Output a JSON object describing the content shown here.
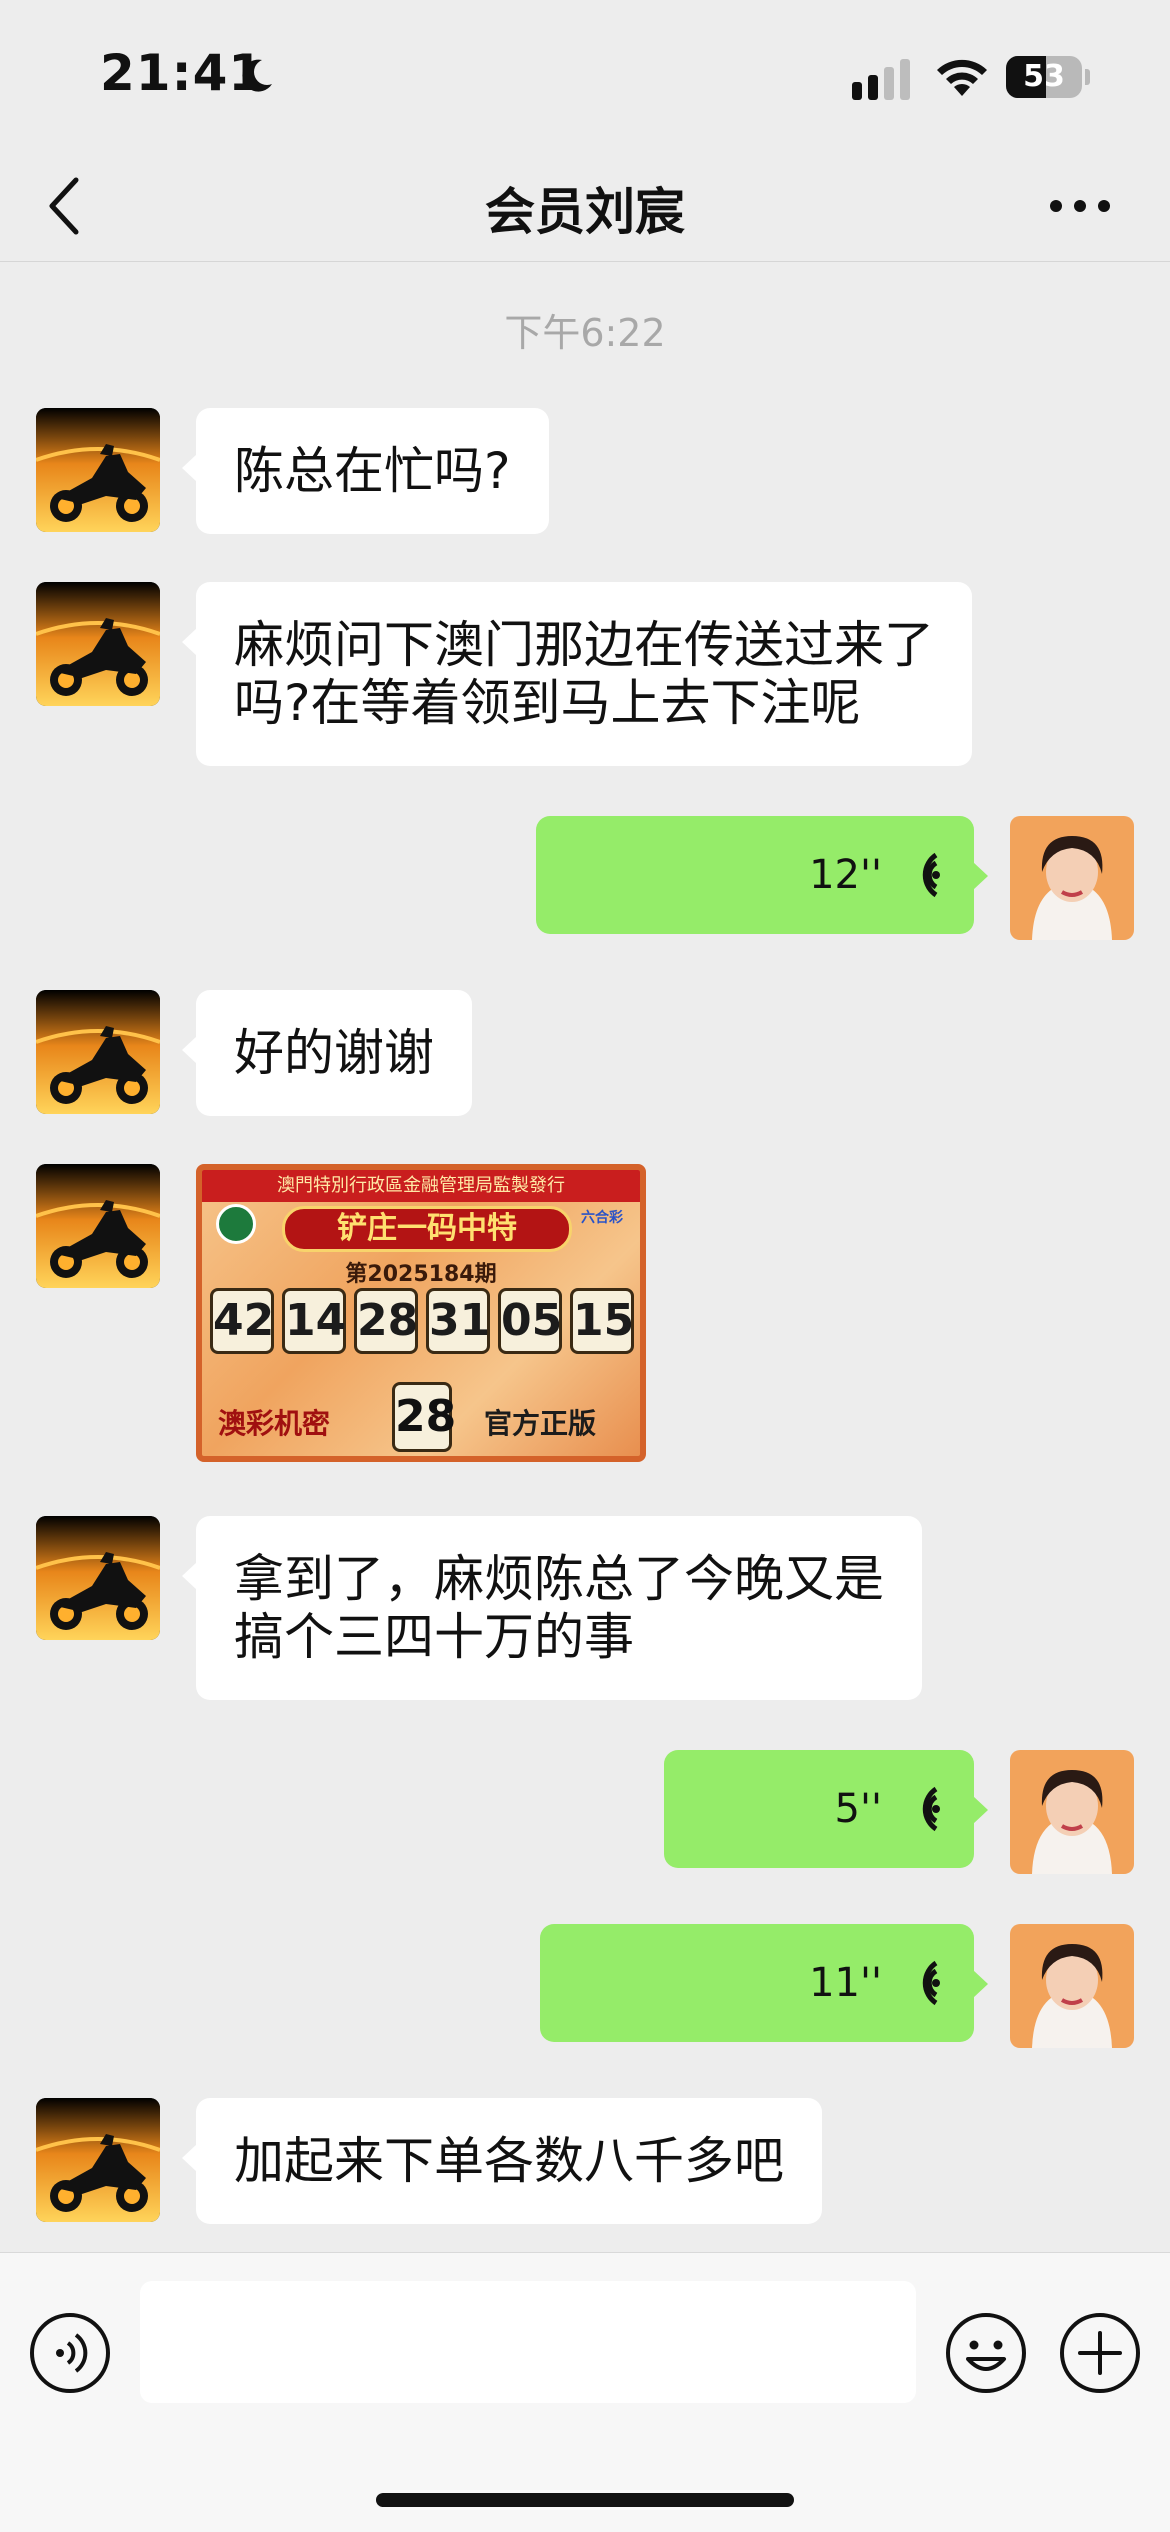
{
  "status_bar": {
    "time": "21:41",
    "moon_icon": "moon-icon",
    "signal_icon": "cellular-signal-icon",
    "wifi_icon": "wifi-icon",
    "battery_level": "53",
    "battery_fraction": 0.53
  },
  "nav": {
    "back_icon": "chevron-left-icon",
    "title": "会员刘宸",
    "more_icon": "more-dots-icon"
  },
  "chat": {
    "timestamp": "下午6:22",
    "messages": [
      {
        "side": "left",
        "type": "text",
        "text": "陈总在忙吗?"
      },
      {
        "side": "left",
        "type": "text",
        "text": "麻烦问下澳门那边在传送过来了\n吗?在等着领到马上去下注呢"
      },
      {
        "side": "right",
        "type": "voice",
        "duration": "12''"
      },
      {
        "side": "left",
        "type": "text",
        "text": "好的谢谢"
      },
      {
        "side": "left",
        "type": "image"
      },
      {
        "side": "left",
        "type": "text",
        "text": "拿到了，麻烦陈总了今晚又是\n搞个三四十万的事"
      },
      {
        "side": "right",
        "type": "voice",
        "duration": "5''"
      },
      {
        "side": "right",
        "type": "voice",
        "duration": "11''"
      },
      {
        "side": "left",
        "type": "text",
        "text": "加起来下单各数八千多吧"
      }
    ]
  },
  "lottery_image": {
    "header": "澳門特別行政區金融管理局監製發行",
    "title": "铲庄一码中特",
    "badge": "六合彩",
    "period": "第2025184期",
    "numbers": [
      "42",
      "14",
      "28",
      "31",
      "05",
      "15"
    ],
    "left_text": "澳彩机密",
    "special": "28",
    "right_text": "官方正版"
  },
  "input_bar": {
    "voice_icon": "voice-input-icon",
    "placeholder": "",
    "emoji_icon": "emoji-icon",
    "plus_icon": "plus-icon"
  },
  "colors": {
    "background": "#ededed",
    "bubble_incoming": "#ffffff",
    "bubble_outgoing": "#95ec69",
    "timestamp": "#a8a8a8"
  }
}
